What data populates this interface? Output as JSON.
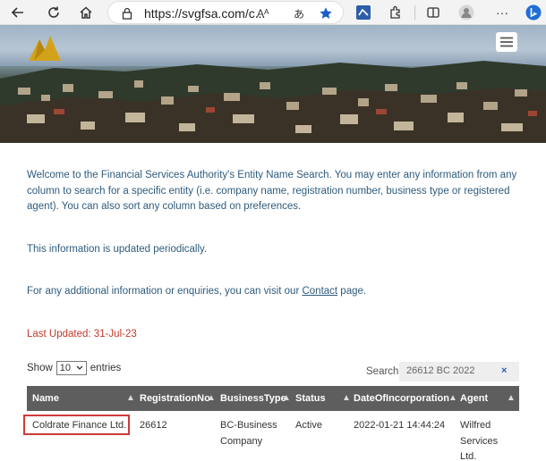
{
  "browser": {
    "url": "https://svgfsa.com/c...",
    "read_aloud": "Aᴬ",
    "translate": "あ"
  },
  "intro": {
    "paragraph1": "Welcome to the Financial Services Authority's Entity Name Search. You may enter any information from any column to search for a specific entity (i.e. company name, registration number, business type or registered agent). You can also sort any column based on preferences.",
    "paragraph2": "This information is updated periodically.",
    "paragraph3_before": "For any additional information or enquiries, you can visit our ",
    "paragraph3_link": "Contact",
    "paragraph3_after": " page.",
    "last_updated": "Last Updated:  31-Jul-23"
  },
  "controls": {
    "show_label": "Show",
    "entries_value": "10",
    "entries_label": "entries",
    "search_label": "Search:",
    "search_value": "26612 BC 2022",
    "search_clear": "×"
  },
  "table": {
    "columns": [
      "Name",
      "RegistrationNo",
      "BusinessType",
      "Status",
      "DateOfIncorporation",
      "Agent"
    ],
    "rows": [
      {
        "name": "Coldrate Finance Ltd.",
        "registration_no": "26612",
        "business_type_line1": "BC-Business",
        "business_type_line2": "Company",
        "status": "Active",
        "date": "2022-01-21 14:44:24",
        "agent_line1": "Wilfred",
        "agent_line2": "Services",
        "agent_line3": "Ltd."
      }
    ]
  },
  "colors": {
    "body_text": "#2e5b7d",
    "last_updated": "#c0392b",
    "table_header": "#5e5e5e",
    "highlight": "#d03a3a"
  }
}
